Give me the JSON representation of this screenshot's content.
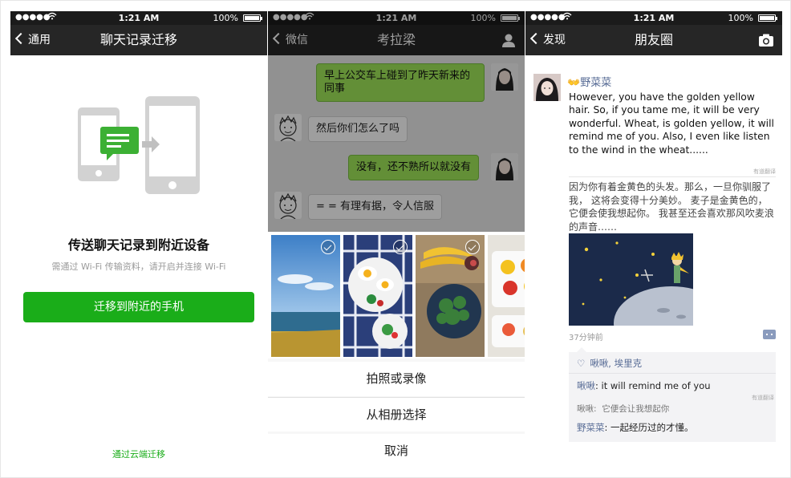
{
  "status_bar": {
    "time": "1:21 AM",
    "battery": "100%"
  },
  "screen_migrate": {
    "nav": {
      "back_label": "通用",
      "title": "聊天记录迁移"
    },
    "heading": "传送聊天记录到附近设备",
    "subtext": "需通过 Wi-Fi 传输资料，请开启并连接 Wi-Fi",
    "primary_button": "迁移到附近的手机",
    "cloud_link": "通过云端迁移"
  },
  "screen_chat": {
    "nav": {
      "back_label": "微信",
      "title": "考拉梁",
      "right_icon": "profile-icon"
    },
    "messages": [
      {
        "side": "right",
        "text": "早上公交车上碰到了昨天新来的同事"
      },
      {
        "side": "left",
        "text": "然后你们怎么了吗"
      },
      {
        "side": "right",
        "text": "没有，还不熟所以就没有"
      },
      {
        "side": "left",
        "text": "= = 有理有据，令人信服"
      }
    ],
    "photos": [
      {
        "subject": "sky-and-sea",
        "selected": true
      },
      {
        "subject": "breakfast-plate",
        "selected": true
      },
      {
        "subject": "greens-and-bananas",
        "selected": true
      },
      {
        "subject": "fruit-tray",
        "selected": true
      }
    ],
    "sheet_options": [
      "拍照或录像",
      "从相册选择"
    ],
    "cancel_label": "取消"
  },
  "screen_moments": {
    "nav": {
      "back_label": "发现",
      "title": "朋友圈",
      "right_icon": "camera-icon"
    },
    "post": {
      "username": "野菜菜",
      "text_en": "However, you have the golden yellow hair. So, if you tame me, it will be very wonderful. Wheat, is golden yellow, it will remind me of you. Also, I even like listen to the wind in the wheat......",
      "translate_tag": "有道翻译",
      "text_cn": "因为你有着金黄色的头发。那么，一旦你驯服了我， 这将会变得十分美妙。 麦子是金黄色的， 它便会使我想起你。 我甚至还会喜欢那风吹麦浪的声音……",
      "time": "37分钟前"
    },
    "likes": "啾啾, 埃里克",
    "comments": [
      {
        "author": "啾啾",
        "text": "it will remind me of you"
      },
      {
        "author": "啾啾",
        "text": "它便会让我想起你",
        "translated": true
      },
      {
        "author": "野菜菜",
        "text": "一起经历过的才懂。"
      }
    ],
    "comment_translate_tag": "有道翻译"
  },
  "colors": {
    "wechat_green": "#1aad19",
    "bubble_green": "#a0e759",
    "nav_dark": "#262626",
    "link_blue": "#576b95"
  }
}
